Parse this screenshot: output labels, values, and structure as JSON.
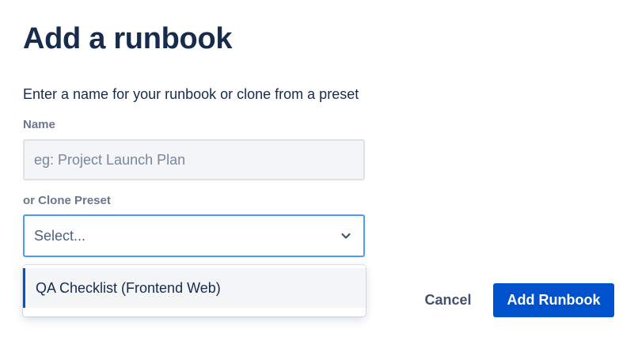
{
  "dialog": {
    "title": "Add a runbook",
    "description": "Enter a name for your runbook or clone from a preset"
  },
  "name_field": {
    "label": "Name",
    "value": "",
    "placeholder": "eg: Project Launch Plan"
  },
  "preset_field": {
    "label": "or Clone Preset",
    "selected": "Select...",
    "chevron_icon": "chevron-down-icon",
    "options": [
      {
        "label": "QA Checklist (Frontend Web)"
      }
    ]
  },
  "actions": {
    "cancel_label": "Cancel",
    "submit_label": "Add Runbook"
  },
  "colors": {
    "heading": "#172b4d",
    "primary": "#0052cc",
    "focus_border": "#4c9aff",
    "subtle_text": "#6b778c"
  }
}
